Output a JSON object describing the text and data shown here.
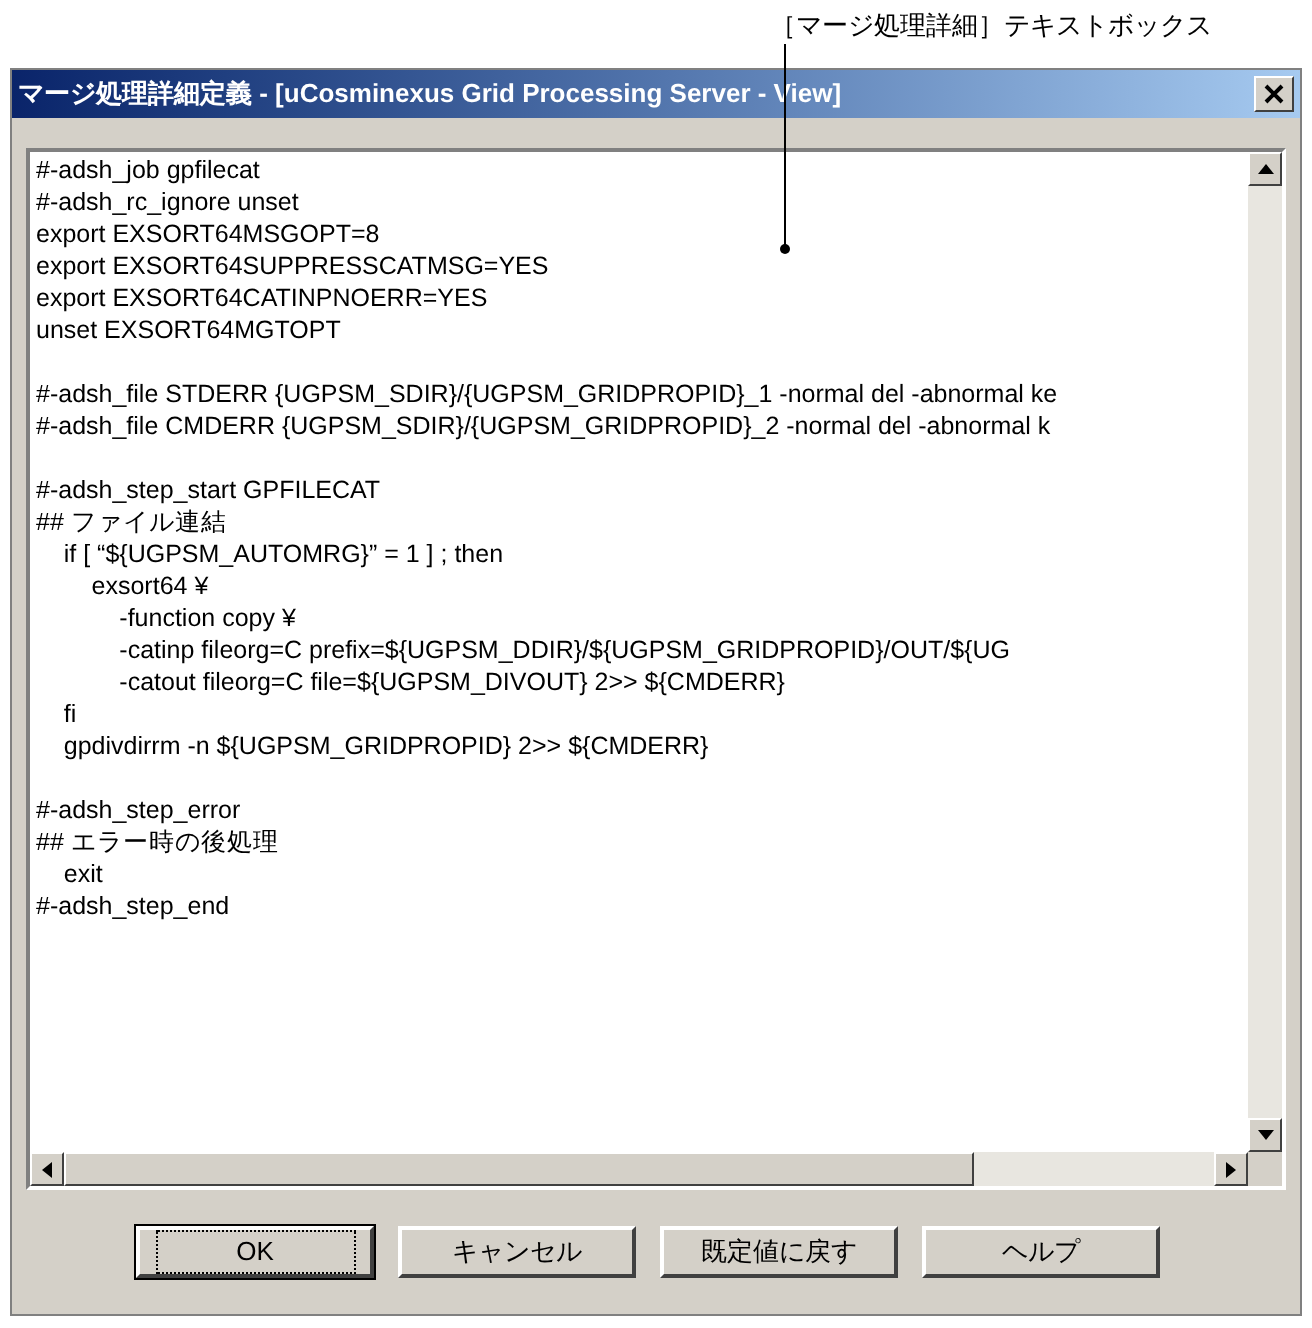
{
  "annotation": {
    "label": "［マージ処理詳細］テキストボックス"
  },
  "window": {
    "title": "マージ処理詳細定義 - [uCosminexus Grid Processing Server - View]"
  },
  "text_box": {
    "blocks": [
      [
        "#-adsh_job gpfilecat",
        "#-adsh_rc_ignore unset",
        "export EXSORT64MSGOPT=8",
        "export EXSORT64SUPPRESSCATMSG=YES",
        "export EXSORT64CATINPNOERR=YES",
        "unset EXSORT64MGTOPT"
      ],
      [
        "#-adsh_file STDERR {UGPSM_SDIR}/{UGPSM_GRIDPROPID}_1 -normal del -abnormal ke",
        "#-adsh_file CMDERR {UGPSM_SDIR}/{UGPSM_GRIDPROPID}_2 -normal del -abnormal k"
      ],
      [
        "#-adsh_step_start GPFILECAT",
        "## ファイル連結",
        "    if [ “${UGPSM_AUTOMRG}” = 1 ] ; then",
        "        exsort64 ¥",
        "            -function copy ¥",
        "            -catinp fileorg=C prefix=${UGPSM_DDIR}/${UGPSM_GRIDPROPID}/OUT/${UG",
        "            -catout fileorg=C file=${UGPSM_DIVOUT} 2>> ${CMDERR}",
        "    fi",
        "    gpdivdirrm -n ${UGPSM_GRIDPROPID} 2>> ${CMDERR}"
      ],
      [
        "#-adsh_step_error",
        "## エラー時の後処理",
        "    exit",
        "#-adsh_step_end"
      ]
    ]
  },
  "buttons": [
    {
      "label": "OK",
      "focused": true
    },
    {
      "label": "キャンセル",
      "focused": false
    },
    {
      "label": "既定値に戻す",
      "focused": false
    },
    {
      "label": "ヘルプ",
      "focused": false
    }
  ]
}
